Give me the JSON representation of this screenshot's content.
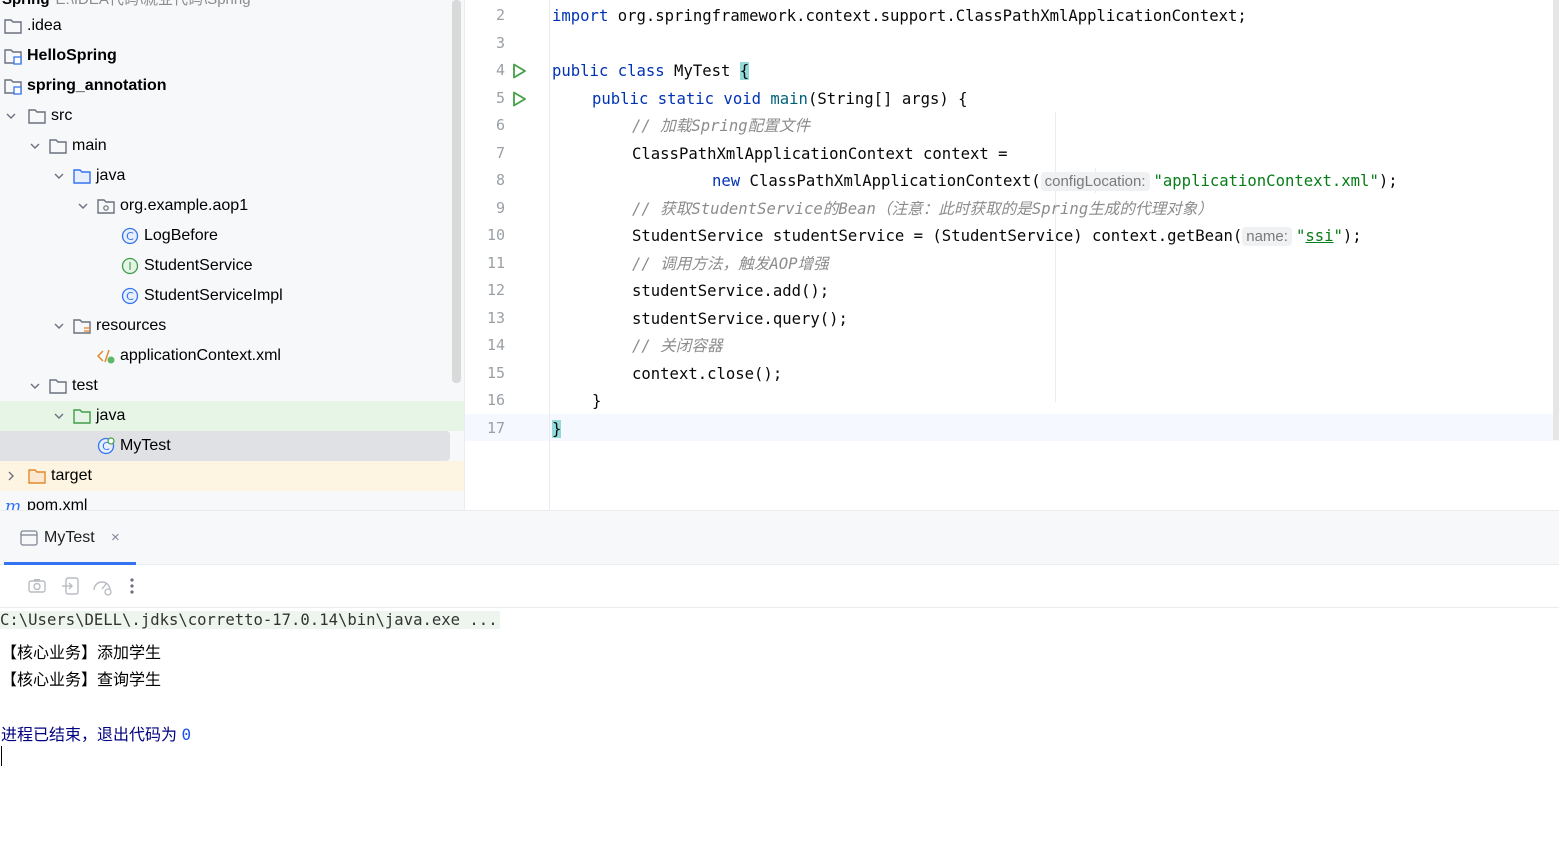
{
  "tree": {
    "root_name": "Spring",
    "root_path": "E:\\IDEA代码\\就业代码\\Spring",
    "items": [
      {
        "label": ".idea",
        "type": "folder",
        "indent": 0,
        "chev": ""
      },
      {
        "label": "HelloSpring",
        "type": "module",
        "indent": 0,
        "chev": "",
        "bold": true
      },
      {
        "label": "spring_annotation",
        "type": "module",
        "indent": 0,
        "chev": "",
        "bold": true
      },
      {
        "label": "src",
        "type": "folder",
        "indent": 0,
        "chev": "down"
      },
      {
        "label": "main",
        "type": "folder",
        "indent": 1,
        "chev": "down"
      },
      {
        "label": "java",
        "type": "src-folder",
        "indent": 2,
        "chev": "down"
      },
      {
        "label": "org.example.aop1",
        "type": "package",
        "indent": 3,
        "chev": "down"
      },
      {
        "label": "LogBefore",
        "type": "class",
        "indent": 4,
        "chev": ""
      },
      {
        "label": "StudentService",
        "type": "interface",
        "indent": 4,
        "chev": ""
      },
      {
        "label": "StudentServiceImpl",
        "type": "class",
        "indent": 4,
        "chev": ""
      },
      {
        "label": "resources",
        "type": "res-folder",
        "indent": 2,
        "chev": "down"
      },
      {
        "label": "applicationContext.xml",
        "type": "xml",
        "indent": 3,
        "chev": ""
      },
      {
        "label": "test",
        "type": "folder",
        "indent": 1,
        "chev": "down"
      },
      {
        "label": "java",
        "type": "test-folder",
        "indent": 2,
        "chev": "down",
        "hl": "green"
      },
      {
        "label": "MyTest",
        "type": "test-class",
        "indent": 3,
        "chev": "",
        "selected": true
      },
      {
        "label": "target",
        "type": "target-folder",
        "indent": 0,
        "chev": "right",
        "hl": "yellow"
      },
      {
        "label": "pom.xml",
        "type": "maven",
        "indent": 0,
        "chev": ""
      }
    ]
  },
  "editor": {
    "line_numbers": [
      "2",
      "3",
      "4",
      "5",
      "6",
      "7",
      "8",
      "9",
      "10",
      "11",
      "12",
      "13",
      "14",
      "15",
      "16",
      "17"
    ],
    "code": {
      "l2_kw": "import",
      "l2_rest": " org.springframework.context.support.ClassPathXmlApplicationContext;",
      "l4_kw": "public class",
      "l4_name": " MyTest ",
      "l4_brace": "{",
      "l5_kw": "public static void",
      "l5_fn": "main",
      "l5_rest": "(String[] args) {",
      "l6_comment": "// 加载Spring配置文件",
      "l7": "ClassPathXmlApplicationContext context =",
      "l8_kw": "new",
      "l8_call": " ClassPathXmlApplicationContext(",
      "l8_hint": "configLocation:",
      "l8_str": "\"applicationContext.xml\"",
      "l8_end": ");",
      "l9_comment": "// 获取StudentService的Bean（注意：此时获取的是Spring生成的代理对象）",
      "l10_a": "StudentService studentService = (StudentService) context.getBean(",
      "l10_hint": "name:",
      "l10_q1": "\"",
      "l10_ssi": "ssi",
      "l10_q2": "\"",
      "l10_end": ");",
      "l11_comment": "// 调用方法，触发AOP增强",
      "l12": "studentService.add();",
      "l13": "studentService.query();",
      "l14_comment": "// 关闭容器",
      "l15": "context.close();",
      "l16": "}",
      "l17": "}"
    }
  },
  "run_panel": {
    "tab_label": "MyTest",
    "close_glyph": "×",
    "toolbar_icons": [
      "stop-icon",
      "screenshot-icon",
      "import-icon",
      "profiler-icon",
      "more-icon"
    ],
    "console": {
      "command": "C:\\Users\\DELL\\.jdks\\corretto-17.0.14\\bin\\java.exe ...",
      "out1": "【核心业务】添加学生",
      "out2": "【核心业务】查询学生",
      "exit_text": "进程已结束，退出代码为 ",
      "exit_code": "0"
    }
  },
  "colors": {
    "keyword": "#0033b3",
    "string": "#067d17",
    "comment": "#8c8c8c",
    "selection": "#dfe1e5",
    "accent": "#3574f0",
    "run_green": "#43a047"
  }
}
